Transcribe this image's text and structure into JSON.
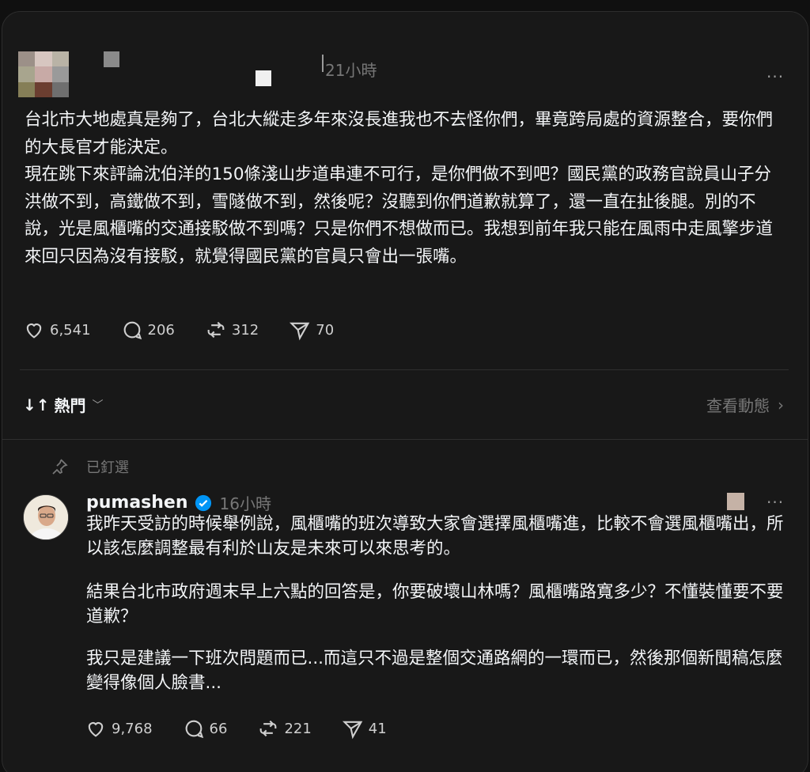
{
  "post": {
    "time": "21小時",
    "more": "···",
    "paragraphs": [
      "台北市大地處真是夠了，台北大縱走多年來沒長進我也不去怪你們，畢竟跨局處的資源整合，要你們的大長官才能決定。",
      "現在跳下來評論沈伯洋的150條淺山步道串連不可行，是你們做不到吧？國民黨的政務官說員山子分洪做不到，高鐵做不到，雪隧做不到，然後呢？沒聽到你們道歉就算了，還一直在扯後腿。別的不說，光是風櫃嘴的交通接駁做不到嗎？只是你們不想做而已。我想到前年我只能在風雨中走風擎步道來回只因為沒有接駁，就覺得國民黨的官員只會出一張嘴。"
    ],
    "likes": "6,541",
    "comments": "206",
    "reposts": "312",
    "shares": "70"
  },
  "sort": {
    "label": "熱門",
    "arrows": "↓↑",
    "view_activity": "查看動態"
  },
  "reply": {
    "pinned_label": "已釘選",
    "username": "pumashen",
    "time": "16小時",
    "more": "···",
    "paragraphs": [
      "我昨天受訪的時候舉例說，風櫃嘴的班次導致大家會選擇風櫃嘴進，比較不會選風櫃嘴出，所以該怎麼調整最有利於山友是未來可以來思考的。",
      "結果台北市政府週末早上六點的回答是，你要破壞山林嗎？風櫃嘴路寬多少？不懂裝懂要不要道歉？",
      "我只是建議一下班次問題而已...而這只不過是整個交通路網的一環而已，然後那個新聞稿怎麼變得像個人臉書..."
    ],
    "likes": "9,768",
    "comments": "66",
    "reposts": "221",
    "shares": "41"
  },
  "colors": {
    "background": "#101010",
    "card": "#181818",
    "text": "#f3f5f7",
    "muted": "#777777",
    "verified": "#0095f6"
  }
}
